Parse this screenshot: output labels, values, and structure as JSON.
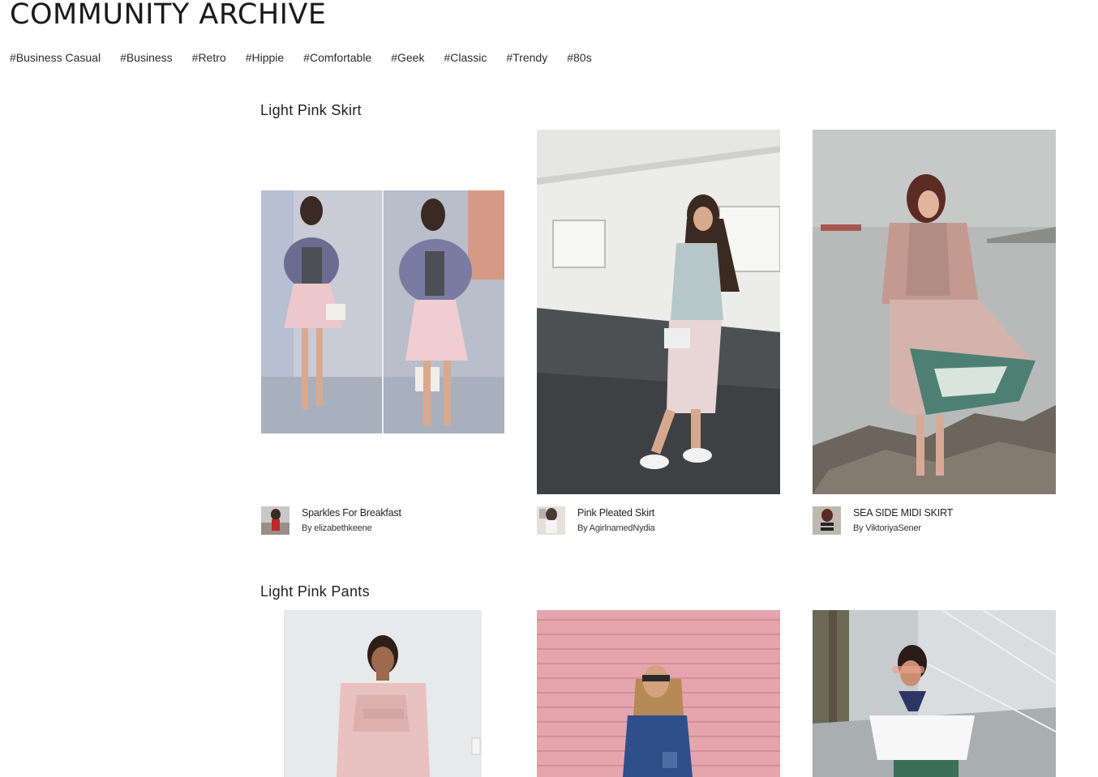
{
  "page": {
    "title": "COMMUNITY ARCHIVE"
  },
  "tags": [
    "#Business Casual",
    "#Business",
    "#Retro",
    "#Hippie",
    "#Comfortable",
    "#Geek",
    "#Classic",
    "#Trendy",
    "#80s"
  ],
  "sections": [
    {
      "title": "Light Pink Skirt",
      "cards": [
        {
          "title": "Sparkles For Breakfast",
          "author": "By elizabethkeene"
        },
        {
          "title": "Pink Pleated Skirt",
          "author": "By AgirlnamedNydia"
        },
        {
          "title": "SEA SIDE MIDI SKIRT",
          "author": "By ViktoriyaSener"
        }
      ]
    },
    {
      "title": "Light Pink Pants",
      "cards": []
    }
  ],
  "colors": {
    "text": "#1e1e1e",
    "background": "#ffffff",
    "accent_pink": "#e8b9c2"
  }
}
